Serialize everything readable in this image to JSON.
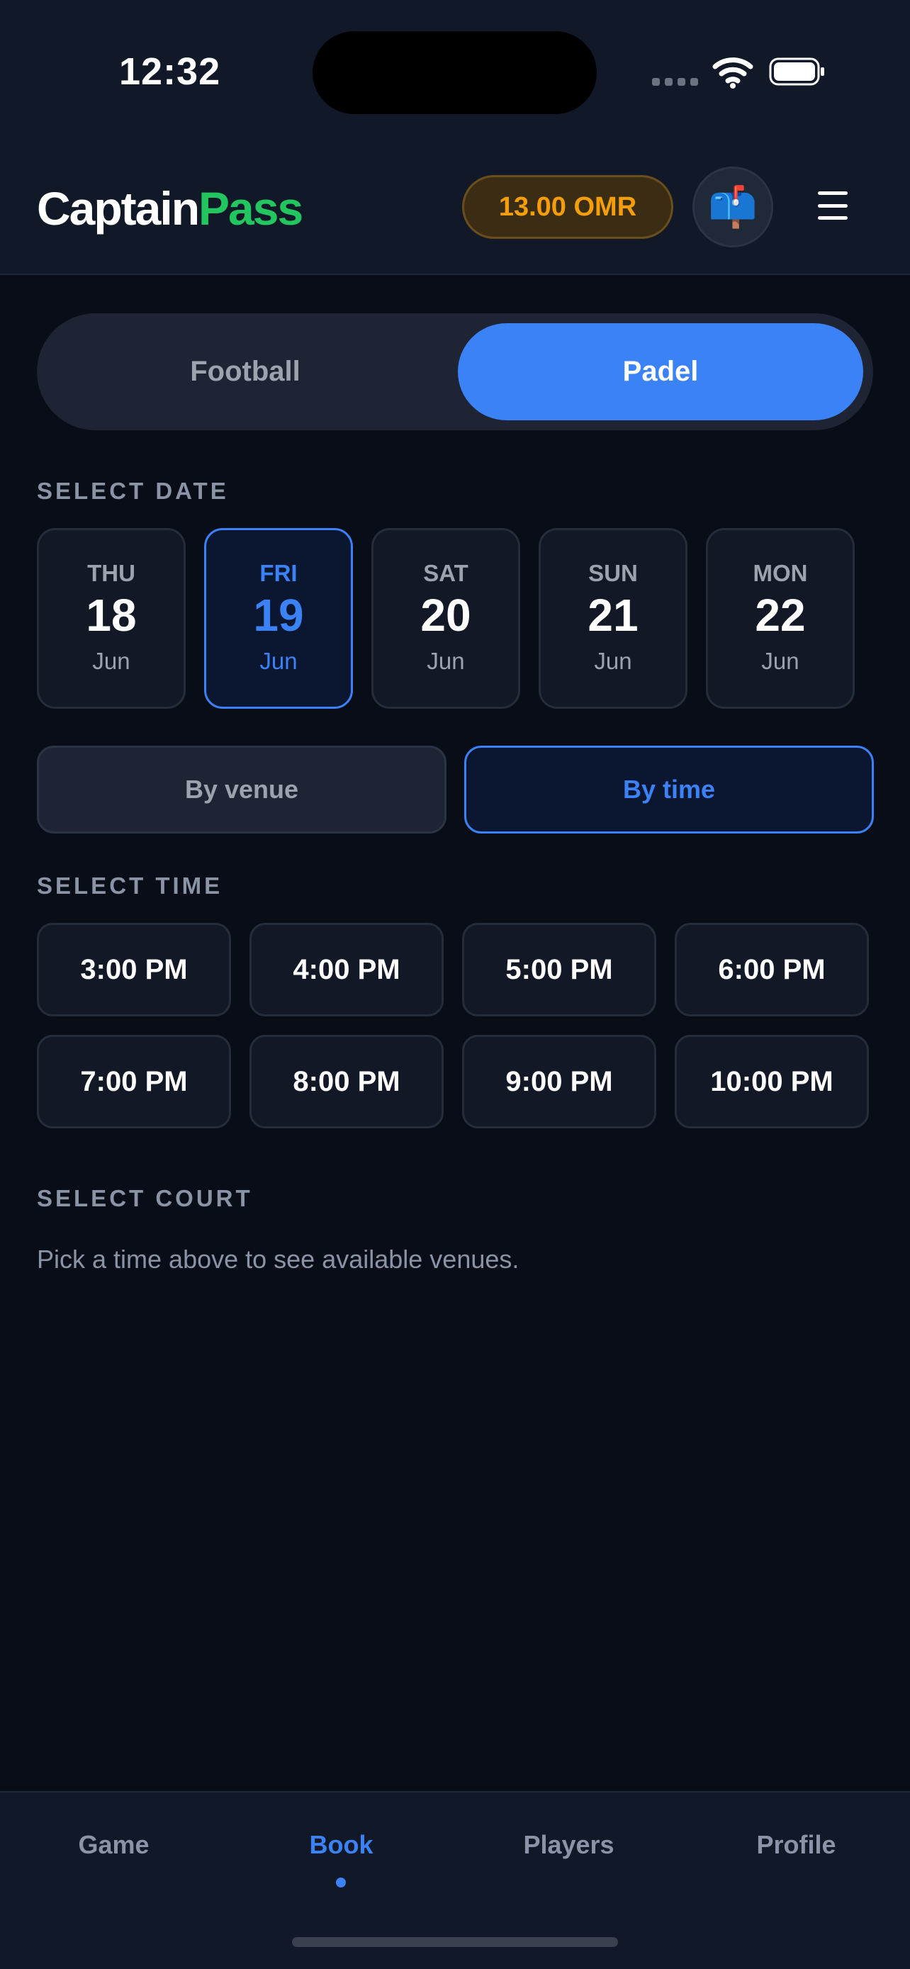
{
  "status_bar": {
    "time": "12:32"
  },
  "header": {
    "logo_part1": "Captain",
    "logo_part2": "Pass",
    "balance": "13.00 OMR",
    "mail_icon": "📫"
  },
  "sport_tabs": [
    {
      "label": "Football",
      "selected": false
    },
    {
      "label": "Padel",
      "selected": true
    }
  ],
  "select_date": {
    "label": "SELECT DATE",
    "dates": [
      {
        "dow": "THU",
        "day": "18",
        "month": "Jun",
        "selected": false
      },
      {
        "dow": "FRI",
        "day": "19",
        "month": "Jun",
        "selected": true
      },
      {
        "dow": "SAT",
        "day": "20",
        "month": "Jun",
        "selected": false
      },
      {
        "dow": "SUN",
        "day": "21",
        "month": "Jun",
        "selected": false
      },
      {
        "dow": "MON",
        "day": "22",
        "month": "Jun",
        "selected": false
      }
    ]
  },
  "mode": {
    "by_venue": "By venue",
    "by_time": "By time",
    "selected": "By time"
  },
  "select_time": {
    "label": "SELECT TIME",
    "slots": [
      "3:00 PM",
      "4:00 PM",
      "5:00 PM",
      "6:00 PM",
      "7:00 PM",
      "8:00 PM",
      "9:00 PM",
      "10:00 PM"
    ]
  },
  "select_court": {
    "label": "SELECT COURT",
    "hint": "Pick a time above to see available venues."
  },
  "bottom_nav": [
    {
      "label": "Game",
      "active": false
    },
    {
      "label": "Book",
      "active": true
    },
    {
      "label": "Players",
      "active": false
    },
    {
      "label": "Profile",
      "active": false
    }
  ],
  "colors": {
    "accent": "#3b82f6",
    "brand_green": "#22c55e",
    "balance": "#f59e0b",
    "background": "#090d17"
  }
}
